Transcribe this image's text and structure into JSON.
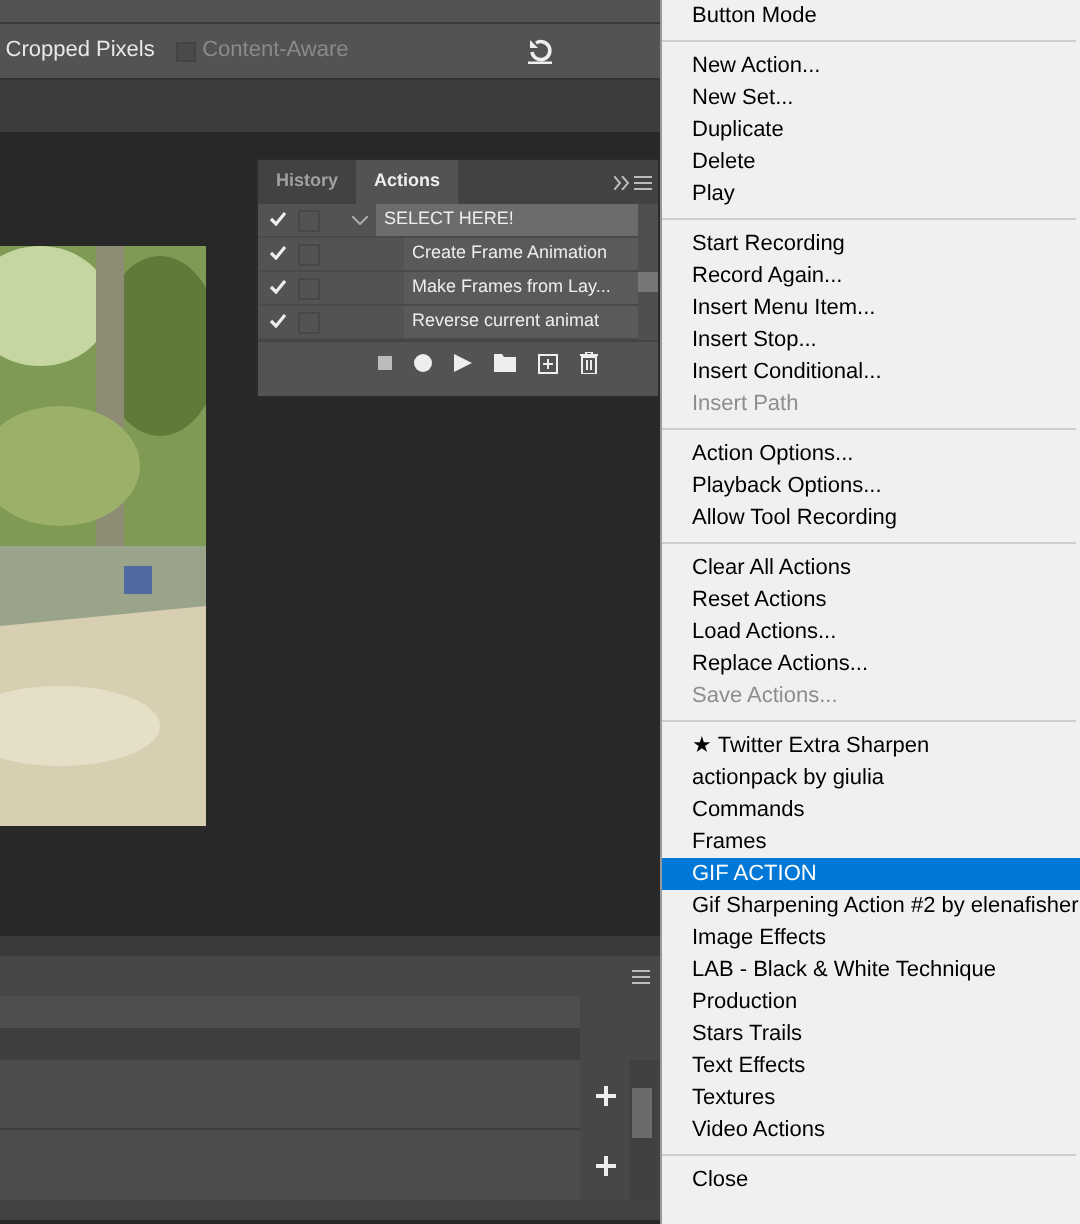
{
  "options_bar": {
    "cropped_label": "Cropped Pixels",
    "content_aware": {
      "label": "Content-Aware",
      "checked": false,
      "disabled": true
    }
  },
  "actions_panel": {
    "tabs": [
      {
        "label": "History",
        "selected": false
      },
      {
        "label": "Actions",
        "selected": true
      }
    ],
    "rows": [
      {
        "label": "SELECT HERE!",
        "kind": "set",
        "checked": true,
        "expanded": true,
        "selected": true
      },
      {
        "label": "Create Frame Animation",
        "kind": "action",
        "checked": true,
        "selected": false
      },
      {
        "label": "Make Frames from Lay...",
        "kind": "action",
        "checked": true,
        "selected": false
      },
      {
        "label": "Reverse current animat",
        "kind": "action",
        "checked": true,
        "selected": false
      }
    ]
  },
  "context_menu": {
    "groups": [
      [
        {
          "label": "Button Mode",
          "disabled": false,
          "selected": false
        }
      ],
      [
        {
          "label": "New Action...",
          "disabled": false,
          "selected": false
        },
        {
          "label": "New Set...",
          "disabled": false,
          "selected": false
        },
        {
          "label": "Duplicate",
          "disabled": false,
          "selected": false
        },
        {
          "label": "Delete",
          "disabled": false,
          "selected": false
        },
        {
          "label": "Play",
          "disabled": false,
          "selected": false
        }
      ],
      [
        {
          "label": "Start Recording",
          "disabled": false,
          "selected": false
        },
        {
          "label": "Record Again...",
          "disabled": false,
          "selected": false
        },
        {
          "label": "Insert Menu Item...",
          "disabled": false,
          "selected": false
        },
        {
          "label": "Insert Stop...",
          "disabled": false,
          "selected": false
        },
        {
          "label": "Insert Conditional...",
          "disabled": false,
          "selected": false
        },
        {
          "label": "Insert Path",
          "disabled": true,
          "selected": false
        }
      ],
      [
        {
          "label": "Action Options...",
          "disabled": false,
          "selected": false
        },
        {
          "label": "Playback Options...",
          "disabled": false,
          "selected": false
        },
        {
          "label": "Allow Tool Recording",
          "disabled": false,
          "selected": false
        }
      ],
      [
        {
          "label": "Clear All Actions",
          "disabled": false,
          "selected": false
        },
        {
          "label": "Reset Actions",
          "disabled": false,
          "selected": false
        },
        {
          "label": "Load Actions...",
          "disabled": false,
          "selected": false
        },
        {
          "label": "Replace Actions...",
          "disabled": false,
          "selected": false
        },
        {
          "label": "Save Actions...",
          "disabled": true,
          "selected": false
        }
      ],
      [
        {
          "label": "★ Twitter Extra Sharpen",
          "disabled": false,
          "selected": false
        },
        {
          "label": "actionpack by giulia",
          "disabled": false,
          "selected": false
        },
        {
          "label": "Commands",
          "disabled": false,
          "selected": false
        },
        {
          "label": "Frames",
          "disabled": false,
          "selected": false
        },
        {
          "label": "GIF ACTION",
          "disabled": false,
          "selected": true
        },
        {
          "label": "Gif Sharpening Action #2 by elenafisher",
          "disabled": false,
          "selected": false
        },
        {
          "label": "Image Effects",
          "disabled": false,
          "selected": false
        },
        {
          "label": "LAB - Black & White Technique",
          "disabled": false,
          "selected": false
        },
        {
          "label": "Production",
          "disabled": false,
          "selected": false
        },
        {
          "label": "Stars Trails",
          "disabled": false,
          "selected": false
        },
        {
          "label": "Text Effects",
          "disabled": false,
          "selected": false
        },
        {
          "label": "Textures",
          "disabled": false,
          "selected": false
        },
        {
          "label": "Video Actions",
          "disabled": false,
          "selected": false
        }
      ],
      [
        {
          "label": "Close",
          "disabled": false,
          "selected": false
        }
      ]
    ]
  }
}
